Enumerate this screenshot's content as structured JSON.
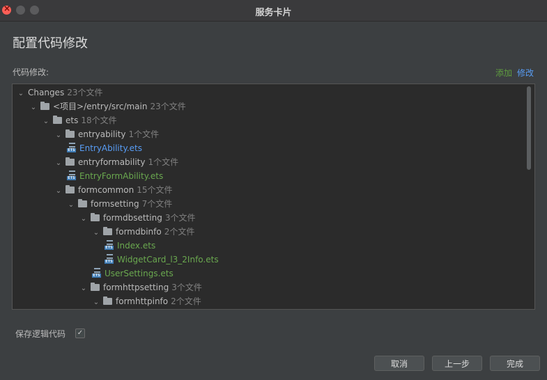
{
  "window": {
    "title": "服务卡片"
  },
  "page": {
    "title": "配置代码修改",
    "section_label": "代码修改:",
    "add_link": "添加",
    "edit_link": "修改"
  },
  "tree": {
    "rows": [
      {
        "name": "Changes",
        "count": "23个文件",
        "type": "root",
        "level": 0
      },
      {
        "name": "<项目>/entry/src/main",
        "count": "23个文件",
        "type": "folder",
        "level": 1
      },
      {
        "name": "ets",
        "count": "18个文件",
        "type": "folder",
        "level": 2
      },
      {
        "name": "entryability",
        "count": "1个文件",
        "type": "folder",
        "level": 3
      },
      {
        "name": "EntryAbility.ets",
        "count": "",
        "type": "file-blue",
        "level": 4
      },
      {
        "name": "entryformability",
        "count": "1个文件",
        "type": "folder",
        "level": 3
      },
      {
        "name": "EntryFormAbility.ets",
        "count": "",
        "type": "file-green",
        "level": 4
      },
      {
        "name": "formcommon",
        "count": "15个文件",
        "type": "folder",
        "level": 3
      },
      {
        "name": "formsetting",
        "count": "7个文件",
        "type": "folder",
        "level": 4
      },
      {
        "name": "formdbsetting",
        "count": "3个文件",
        "type": "folder",
        "level": 5
      },
      {
        "name": "formdbinfo",
        "count": "2个文件",
        "type": "folder",
        "level": 6
      },
      {
        "name": "Index.ets",
        "count": "",
        "type": "file-green",
        "level": 7
      },
      {
        "name": "WidgetCard_l3_2Info.ets",
        "count": "",
        "type": "file-green",
        "level": 7
      },
      {
        "name": "UserSettings.ets",
        "count": "",
        "type": "file-green",
        "level": 6
      },
      {
        "name": "formhttpsetting",
        "count": "3个文件",
        "type": "folder",
        "level": 5
      },
      {
        "name": "formhttpinfo",
        "count": "2个文件",
        "type": "folder",
        "level": 6
      }
    ],
    "file_tag": "ETS"
  },
  "options": {
    "keep_logic_label": "保存逻辑代码",
    "keep_logic_checked": true,
    "check_glyph": "✓"
  },
  "buttons": {
    "cancel": "取消",
    "prev": "上一步",
    "finish": "完成"
  },
  "colors": {
    "accent_blue": "#589df6",
    "accent_green": "#6aa84f",
    "background": "#3c3f41"
  },
  "icons": {
    "chevron": "chevron-down-icon",
    "folder": "folder-icon",
    "file": "ets-file-icon"
  }
}
